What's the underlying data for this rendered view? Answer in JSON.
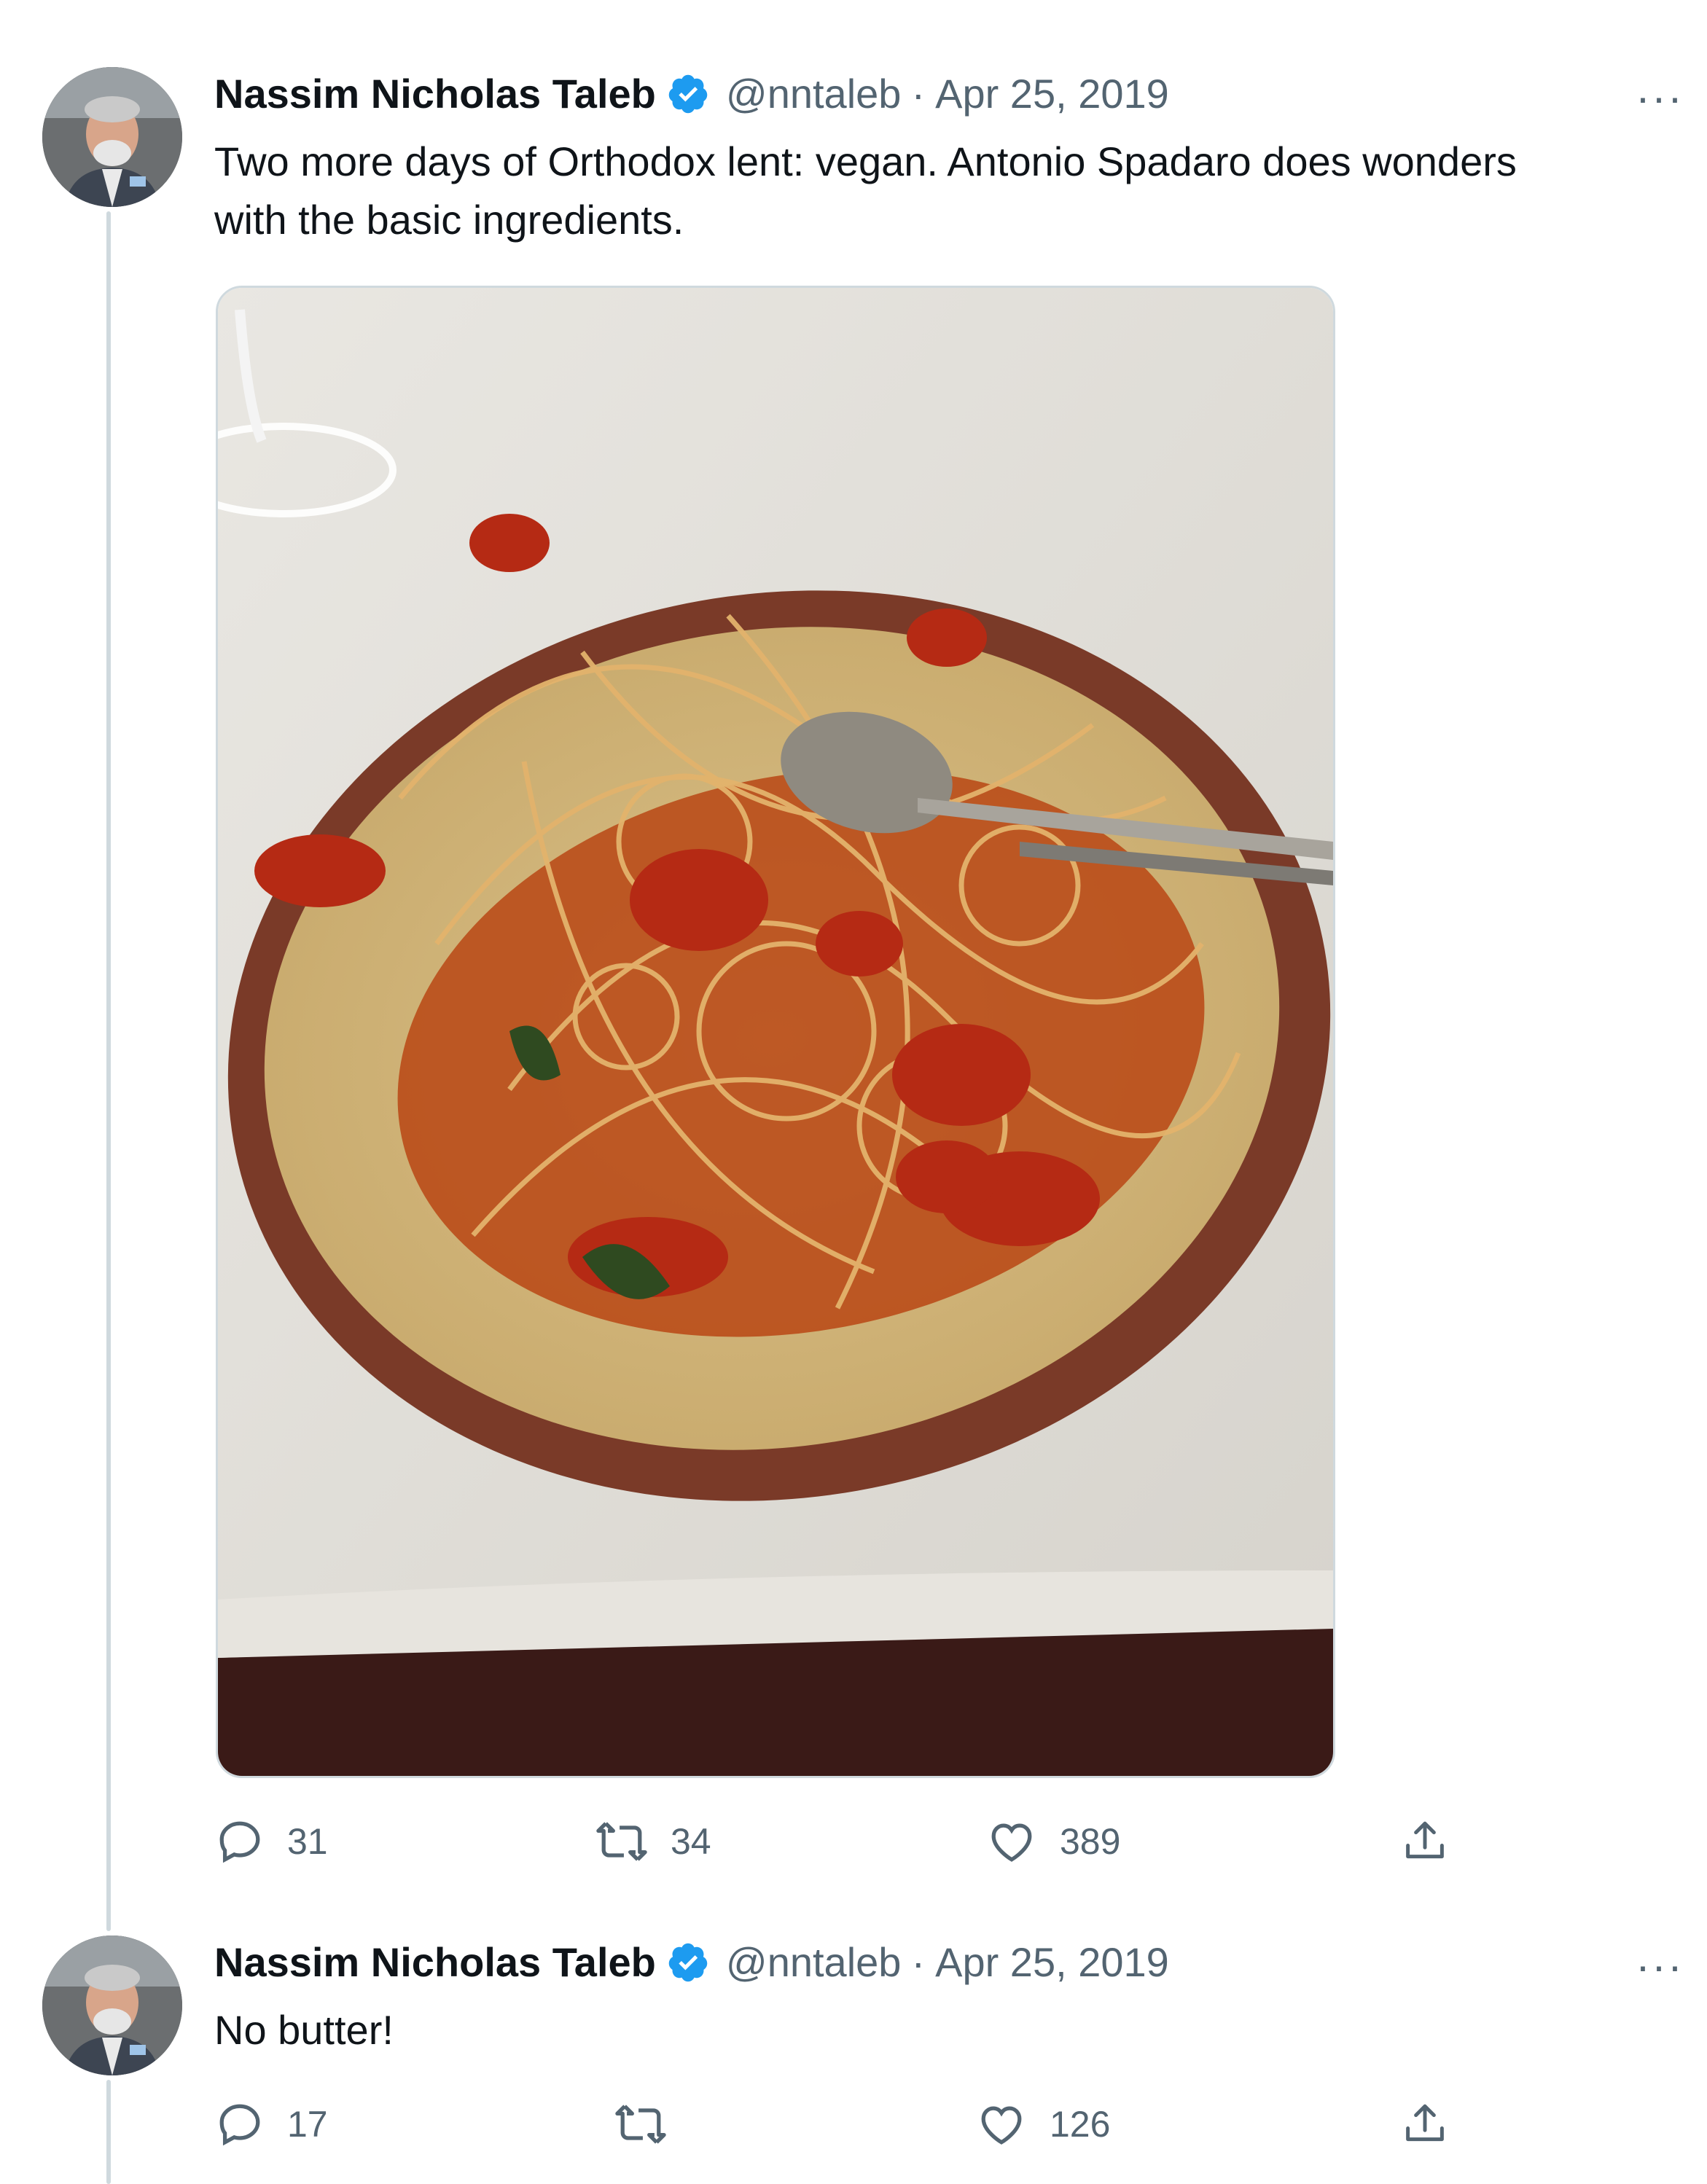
{
  "tweets": [
    {
      "author_name": "Nassim Nicholas Taleb",
      "handle": "@nntaleb",
      "separator": "·",
      "date": "Apr 25, 2019",
      "text_line1": "Two more days of Orthodox lent: vegan. Antonio Spadaro does wonders",
      "text_line2": "with the basic ingredients.",
      "media": "photo of spaghetti with cherry tomato sauce on a brown-rimmed plate",
      "replies": "31",
      "retweets": "34",
      "likes": "389",
      "more_label": "···"
    },
    {
      "author_name": "Nassim Nicholas Taleb",
      "handle": "@nntaleb",
      "separator": "·",
      "date": "Apr 25, 2019",
      "text_line1": "No butter!",
      "replies": "17",
      "retweets": "",
      "likes": "126",
      "more_label": "···"
    }
  ],
  "icons": {
    "verified": "verified-badge-icon",
    "reply": "reply-icon",
    "retweet": "retweet-icon",
    "like": "heart-icon",
    "share": "share-icon",
    "more": "more-icon"
  },
  "colors": {
    "verified_blue": "#1d9bf0",
    "secondary_text": "#536471",
    "thread_line": "#cfd9de"
  }
}
